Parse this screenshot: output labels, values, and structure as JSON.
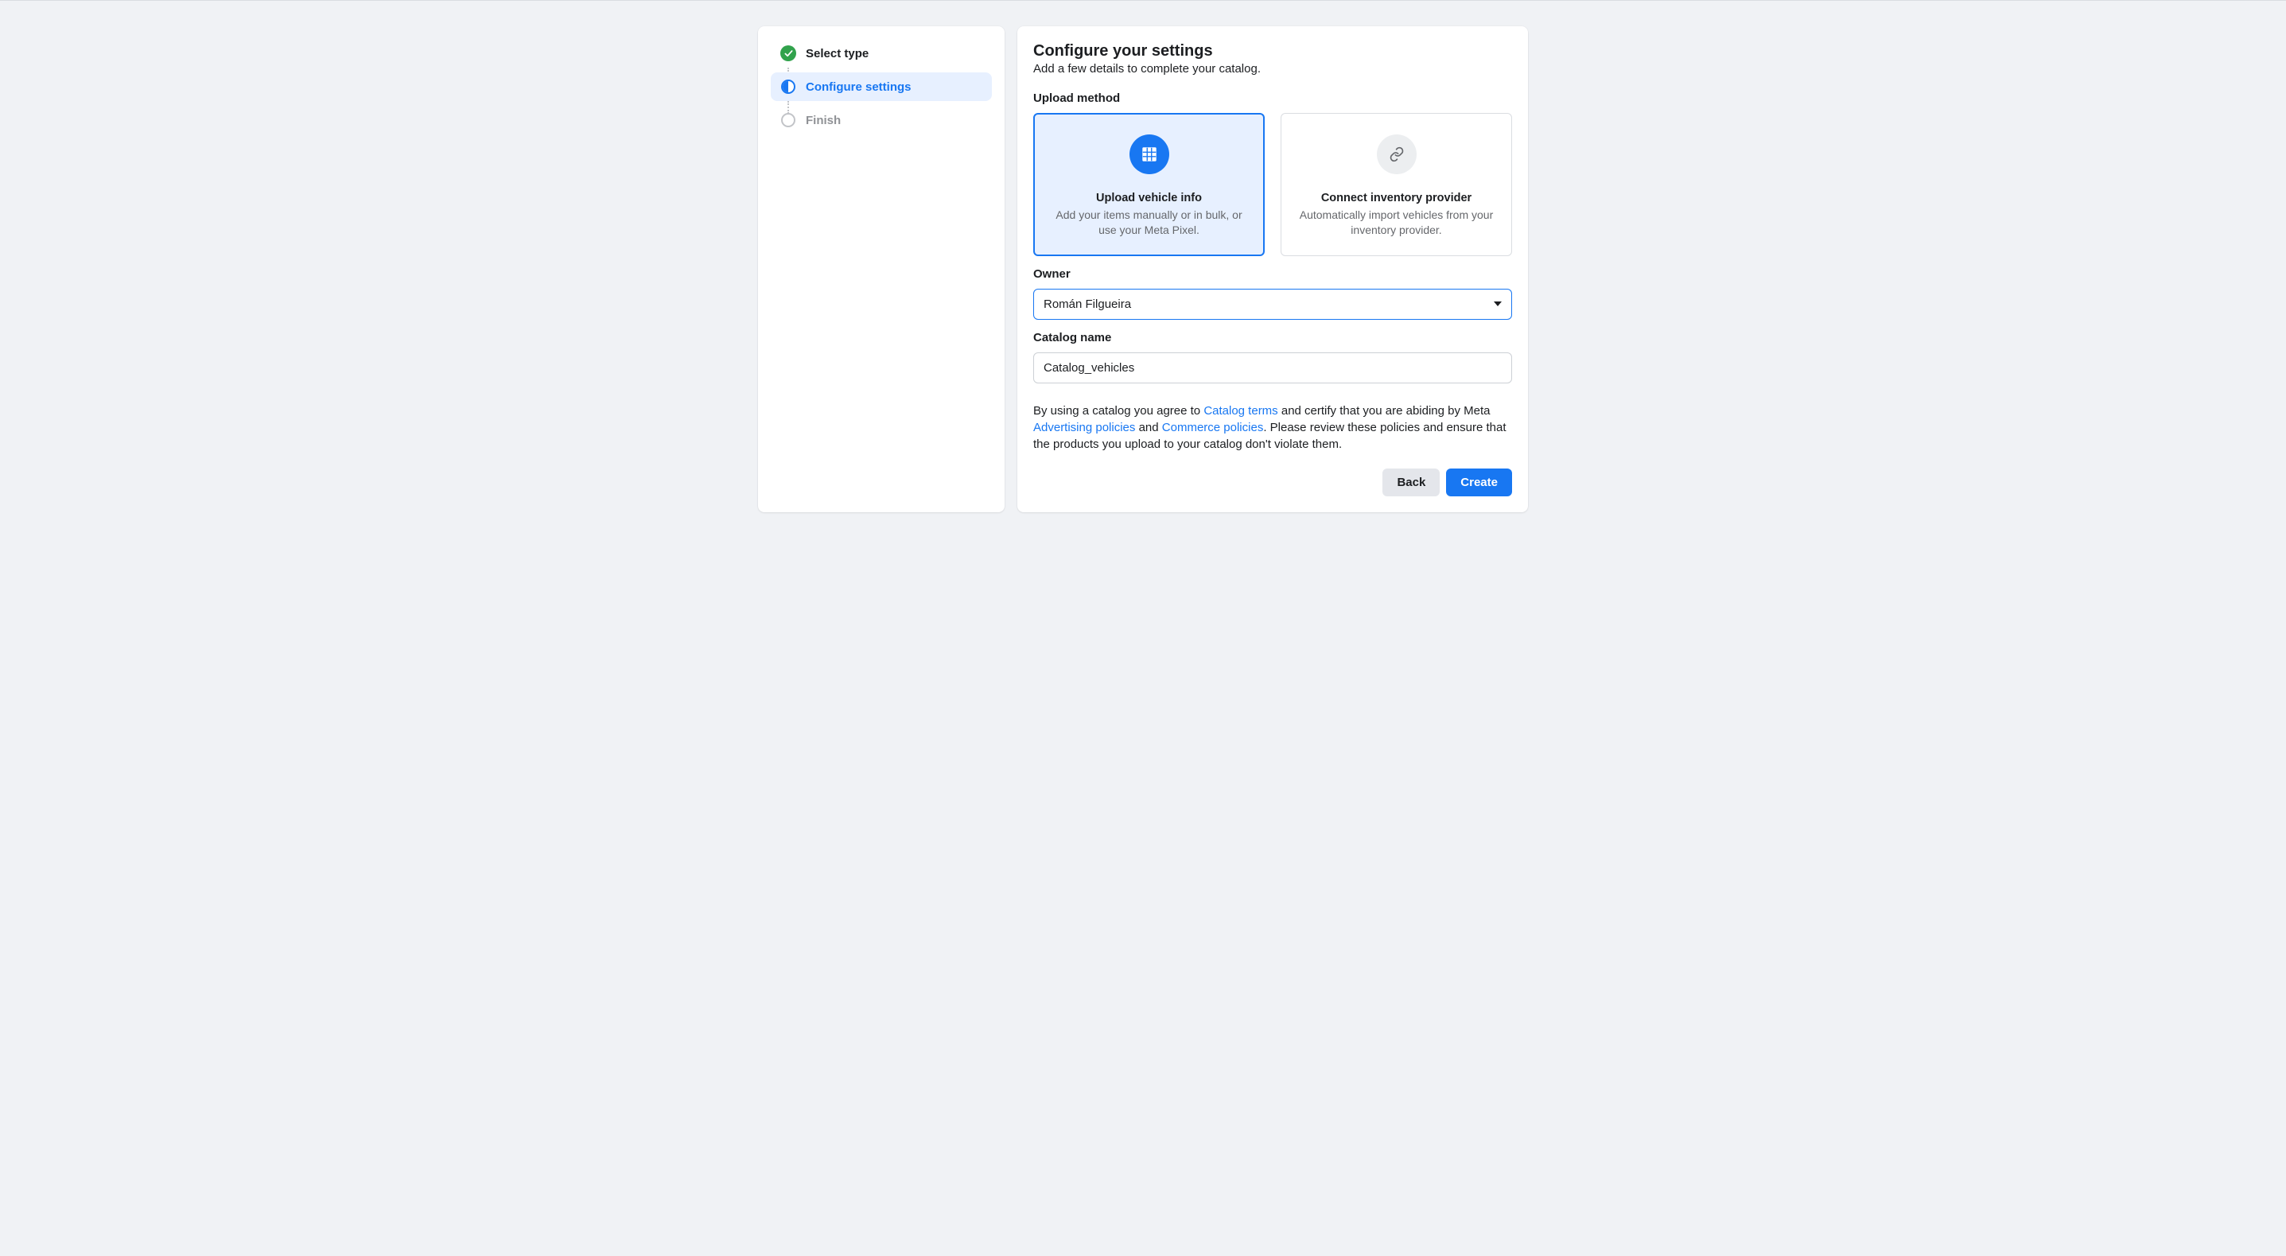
{
  "steps": [
    {
      "label": "Select type",
      "state": "completed"
    },
    {
      "label": "Configure settings",
      "state": "active"
    },
    {
      "label": "Finish",
      "state": "pending"
    }
  ],
  "header": {
    "title": "Configure your settings",
    "subtitle": "Add a few details to complete your catalog."
  },
  "upload_method": {
    "label": "Upload method",
    "options": [
      {
        "title": "Upload vehicle info",
        "desc": "Add your items manually or in bulk, or use your Meta Pixel.",
        "selected": true
      },
      {
        "title": "Connect inventory provider",
        "desc": "Automatically import vehicles from your inventory provider.",
        "selected": false
      }
    ]
  },
  "owner": {
    "label": "Owner",
    "value": "Román Filgueira"
  },
  "catalog_name": {
    "label": "Catalog name",
    "value": "Catalog_vehicles"
  },
  "terms": {
    "pre": "By using a catalog you agree to ",
    "link1": "Catalog terms",
    "mid1": " and certify that you are abiding by Meta ",
    "link2": "Advertising policies",
    "mid2": " and ",
    "link3": "Commerce policies",
    "post": ". Please review these policies and ensure that the products you upload to your catalog don't violate them."
  },
  "buttons": {
    "back": "Back",
    "create": "Create"
  }
}
